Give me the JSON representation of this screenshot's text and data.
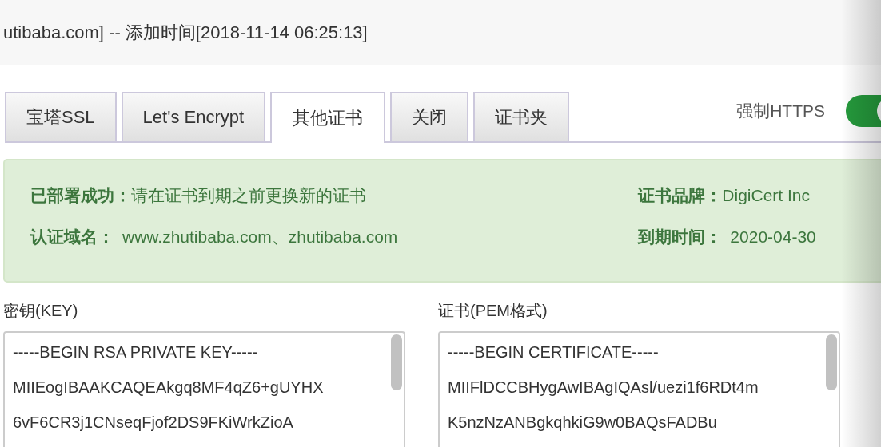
{
  "header": {
    "title": "utibaba.com] -- 添加时间[2018-11-14 06:25:13]"
  },
  "tabs": [
    {
      "label": "宝塔SSL",
      "selected": false
    },
    {
      "label": "Let's Encrypt",
      "selected": false
    },
    {
      "label": "其他证书",
      "selected": true
    },
    {
      "label": "关闭",
      "selected": false
    },
    {
      "label": "证书夹",
      "selected": false
    }
  ],
  "force_https": {
    "label": "强制HTTPS",
    "on": true
  },
  "status": {
    "deployed_label": "已部署成功：",
    "deployed_text": "请在证书到期之前更换新的证书",
    "domains_label": "认证域名：",
    "domains": "www.zhutibaba.com、zhutibaba.com",
    "brand_label": "证书品牌：",
    "brand": "DigiCert Inc",
    "expiry_label": "到期时间：",
    "expiry": "2020-04-30"
  },
  "key": {
    "label": "密钥(KEY)",
    "value": "-----BEGIN RSA PRIVATE KEY-----\nMIIEogIBAAKCAQEAkgq8MF4qZ6+gUYHX\n6vF6CR3j1CNseqFjof2DS9FKiWrkZioA"
  },
  "cert": {
    "label": "证书(PEM格式)",
    "value": "-----BEGIN CERTIFICATE-----\nMIIFlDCCBHygAwIBAgIQAsl/uezi1f6RDt4m\nK5nzNzANBgkqhkiG9w0BAQsFADBu"
  }
}
